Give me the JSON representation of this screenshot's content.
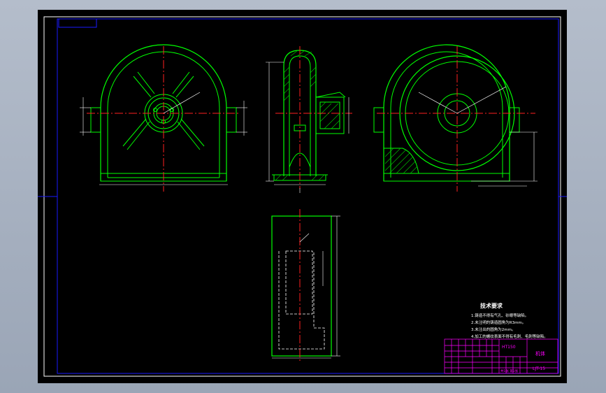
{
  "drawing": {
    "colors": {
      "background": "#000000",
      "frame": "#1a1aff",
      "outline": "#00ff00",
      "centerline": "#ff2020",
      "dimension": "#ffffff",
      "hidden": "#ffffff",
      "hatch": "#00c800",
      "text": "#ffffff",
      "titleblock": "#ff00ff"
    }
  },
  "tech_requirements": {
    "title": "技术要求",
    "items": [
      "1.铸造不得有气孔、砂眼等缺陷。",
      "2.未注明的铸造圆角为R3mm。",
      "3.未注出的圆角为2mm。",
      "4.加工的螺纹表面不得有毛刺、毛刺等缺陷。"
    ]
  },
  "title_block": {
    "material": "HT150",
    "part_name": "机体",
    "drawing_no": "LJT-15",
    "scale_row": "共1张 第1张"
  }
}
